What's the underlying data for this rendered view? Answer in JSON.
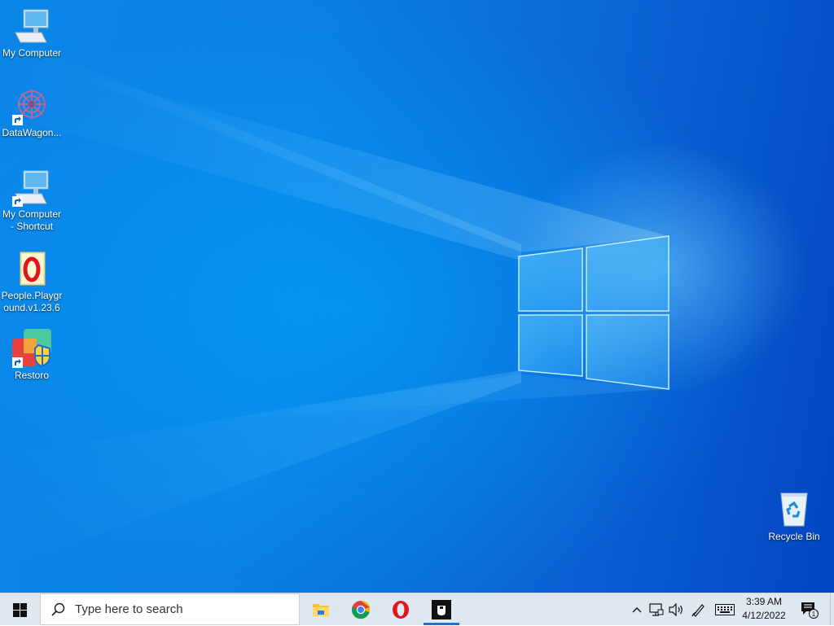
{
  "desktop": {
    "icons": [
      {
        "name": "my-computer",
        "label": "My Computer"
      },
      {
        "name": "datawagon",
        "label": "DataWagon..."
      },
      {
        "name": "my-computer-shortcut",
        "label": "My Computer - Shortcut"
      },
      {
        "name": "people-playground",
        "label": "People.Playground.v1.23.6"
      },
      {
        "name": "restoro",
        "label": "Restoro"
      },
      {
        "name": "recycle-bin",
        "label": "Recycle Bin"
      }
    ]
  },
  "taskbar": {
    "search_placeholder": "Type here to search",
    "apps": [
      {
        "name": "file-explorer",
        "icon": "folder-icon"
      },
      {
        "name": "chrome",
        "icon": "chrome-icon"
      },
      {
        "name": "opera",
        "icon": "opera-icon"
      },
      {
        "name": "app-window",
        "icon": "app-window-icon",
        "active": true
      }
    ],
    "tray": {
      "icons": [
        "chevron-up-icon",
        "network-icon",
        "volume-icon",
        "pen-icon",
        "keyboard-icon"
      ],
      "time": "3:39 AM",
      "date": "4/12/2022",
      "notification_count": "1"
    }
  },
  "colors": {
    "taskbar_bg": "#dfe8f1",
    "accent": "#1f72c9",
    "desktop_blue": "#0b7fe6"
  }
}
